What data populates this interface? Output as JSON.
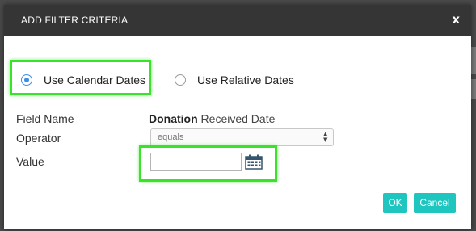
{
  "dialog": {
    "title": "ADD FILTER CRITERIA",
    "close_label": "x"
  },
  "date_mode": {
    "options": [
      {
        "label": "Use Calendar Dates",
        "selected": true
      },
      {
        "label": "Use Relative Dates",
        "selected": false
      }
    ]
  },
  "form": {
    "field_name_label": "Field Name",
    "field_name_value_bold": "Donation",
    "field_name_value_rest": " Received Date",
    "operator_label": "Operator",
    "operator_selected": "equals",
    "value_label": "Value",
    "value_input": "",
    "calendar_icon": "calendar-icon"
  },
  "buttons": {
    "ok_label": "OK",
    "cancel_label": "Cancel"
  },
  "colors": {
    "header_bg": "#353535",
    "accent": "#1fc6c0",
    "radio_accent": "#3b8ee8",
    "highlight": "#39e32a"
  }
}
